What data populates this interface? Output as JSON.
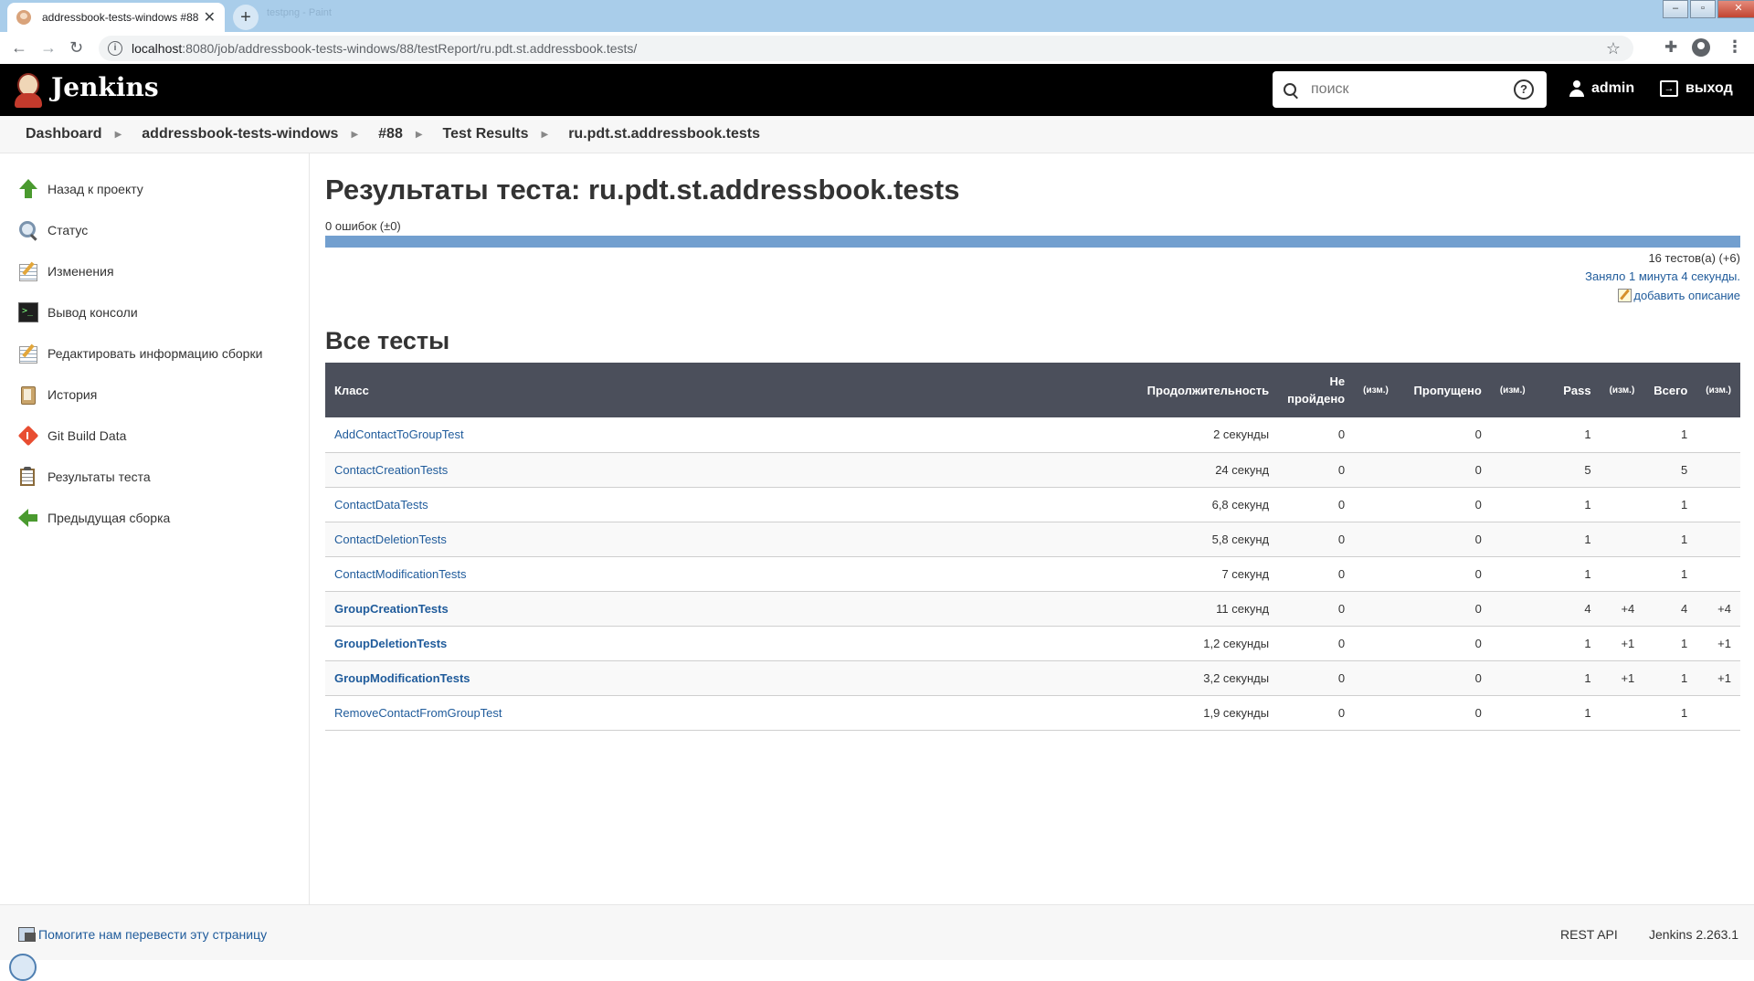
{
  "browser": {
    "tab_title": "addressbook-tests-windows #88",
    "second_tab_text": "testpng - Paint",
    "url_host": "localhost",
    "url_path": ":8080/job/addressbook-tests-windows/88/testReport/ru.pdt.st.addressbook.tests/"
  },
  "header": {
    "brand": "Jenkins",
    "search_placeholder": "поиск",
    "user": "admin",
    "logout": "выход"
  },
  "breadcrumb": [
    "Dashboard",
    "addressbook-tests-windows",
    "#88",
    "Test Results",
    "ru.pdt.st.addressbook.tests"
  ],
  "sidebar": {
    "items": [
      {
        "label": "Назад к проекту",
        "icon": "up-arrow-icon"
      },
      {
        "label": "Статус",
        "icon": "magnifier-icon"
      },
      {
        "label": "Изменения",
        "icon": "notepad-icon"
      },
      {
        "label": "Вывод консоли",
        "icon": "console-icon"
      },
      {
        "label": "Редактировать информацию сборки",
        "icon": "notepad-icon"
      },
      {
        "label": "История",
        "icon": "history-icon"
      },
      {
        "label": "Git Build Data",
        "icon": "git-icon"
      },
      {
        "label": "Результаты теста",
        "icon": "clipboard-icon"
      },
      {
        "label": "Предыдущая сборка",
        "icon": "left-arrow-icon"
      }
    ]
  },
  "report": {
    "title": "Результаты теста: ru.pdt.st.addressbook.tests",
    "failures_summary": "0 ошибок (±0)",
    "pass_fraction": 1.0,
    "test_count": "16 тестов(а) (+6)",
    "took": "Заняло 1 минута 4 секунды.",
    "add_description": "добавить описание",
    "section_title": "Все тесты",
    "columns": {
      "class": "Класс",
      "duration": "Продолжительность",
      "failed_line1": "Не",
      "failed_line2": "пройдено",
      "diff": "(изм.)",
      "skipped": "Пропущено",
      "pass": "Pass",
      "total": "Всего"
    },
    "rows": [
      {
        "name": "AddContactToGroupTest",
        "duration": "2 секунды",
        "fail": "0",
        "fail_diff": "",
        "skip": "0",
        "skip_diff": "",
        "pass": "1",
        "pass_diff": "",
        "total": "1",
        "total_diff": "",
        "changed": false
      },
      {
        "name": "ContactCreationTests",
        "duration": "24 секунд",
        "fail": "0",
        "fail_diff": "",
        "skip": "0",
        "skip_diff": "",
        "pass": "5",
        "pass_diff": "",
        "total": "5",
        "total_diff": "",
        "changed": false
      },
      {
        "name": "ContactDataTests",
        "duration": "6,8 секунд",
        "fail": "0",
        "fail_diff": "",
        "skip": "0",
        "skip_diff": "",
        "pass": "1",
        "pass_diff": "",
        "total": "1",
        "total_diff": "",
        "changed": false
      },
      {
        "name": "ContactDeletionTests",
        "duration": "5,8 секунд",
        "fail": "0",
        "fail_diff": "",
        "skip": "0",
        "skip_diff": "",
        "pass": "1",
        "pass_diff": "",
        "total": "1",
        "total_diff": "",
        "changed": false
      },
      {
        "name": "ContactModificationTests",
        "duration": "7 секунд",
        "fail": "0",
        "fail_diff": "",
        "skip": "0",
        "skip_diff": "",
        "pass": "1",
        "pass_diff": "",
        "total": "1",
        "total_diff": "",
        "changed": false
      },
      {
        "name": "GroupCreationTests",
        "duration": "11 секунд",
        "fail": "0",
        "fail_diff": "",
        "skip": "0",
        "skip_diff": "",
        "pass": "4",
        "pass_diff": "+4",
        "total": "4",
        "total_diff": "+4",
        "changed": true
      },
      {
        "name": "GroupDeletionTests",
        "duration": "1,2 секунды",
        "fail": "0",
        "fail_diff": "",
        "skip": "0",
        "skip_diff": "",
        "pass": "1",
        "pass_diff": "+1",
        "total": "1",
        "total_diff": "+1",
        "changed": true
      },
      {
        "name": "GroupModificationTests",
        "duration": "3,2 секунды",
        "fail": "0",
        "fail_diff": "",
        "skip": "0",
        "skip_diff": "",
        "pass": "1",
        "pass_diff": "+1",
        "total": "1",
        "total_diff": "+1",
        "changed": true
      },
      {
        "name": "RemoveContactFromGroupTest",
        "duration": "1,9 секунды",
        "fail": "0",
        "fail_diff": "",
        "skip": "0",
        "skip_diff": "",
        "pass": "1",
        "pass_diff": "",
        "total": "1",
        "total_diff": "",
        "changed": false
      }
    ]
  },
  "footer": {
    "translate": "Помогите нам перевести эту страницу",
    "rest_api": "REST API",
    "version": "Jenkins 2.263.1"
  },
  "colors": {
    "header_bg": "#000000",
    "table_header_bg": "#4b4f5b",
    "progress_pass": "#729fcf",
    "link": "#1f5b9b"
  }
}
